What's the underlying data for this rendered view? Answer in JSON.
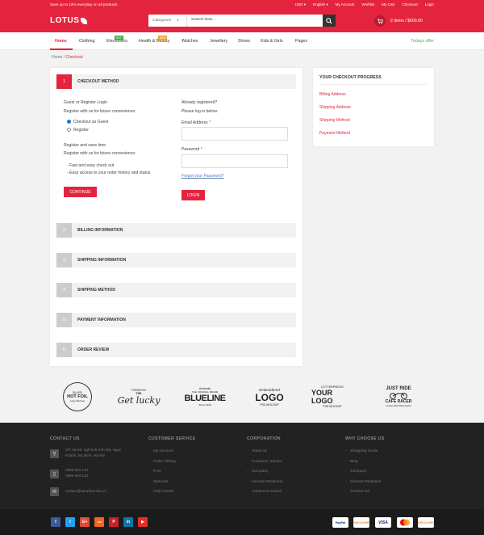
{
  "topbar": {
    "promo": "Save up to 12% everyday on all products",
    "currency": "USD ▾",
    "language": "English ▾",
    "links": [
      "My Account",
      "Wishlist",
      "My Cart",
      "Checkout",
      "Login"
    ]
  },
  "header": {
    "logo": "LOTUS",
    "search": {
      "category": "Categories",
      "placeholder": "Search here..."
    },
    "cart": "2 items / $600.00"
  },
  "nav": {
    "items": [
      "Home",
      "Clothing",
      "Electronics",
      "Health & Beauty",
      "Watches",
      "Jewellery",
      "Shoes",
      "Kids & Girls",
      "Pages"
    ],
    "badges": {
      "electronics": "HOT",
      "health": "NEW"
    },
    "today": "Todays offer"
  },
  "breadcrumb": {
    "home": "Home",
    "current": "Checkout"
  },
  "checkout": {
    "sections": [
      {
        "num": "1",
        "label": "CHECKOUT METHOD"
      },
      {
        "num": "2",
        "label": "BILLING INFORMATION"
      },
      {
        "num": "3",
        "label": "SHIPPING INFORMATION"
      },
      {
        "num": "4",
        "label": "SHIPPING METHOD"
      },
      {
        "num": "5",
        "label": "PAYMENT INFORMATION"
      },
      {
        "num": "6",
        "label": "ORDER REVIEW"
      }
    ],
    "left": {
      "heading": "Guest or Register Login",
      "register_text": "Register with us for future convenience:",
      "options": [
        "Checkout as Guest",
        "Register"
      ],
      "save_heading": "Register and save time",
      "save_text": "Register with us for future convenience:",
      "bullets": [
        "- Fast and easy check out",
        "- Easy access to your order history and status"
      ],
      "continue": "CONTINUE"
    },
    "right": {
      "heading": "Already registered?",
      "text": "Please log in below:",
      "email_label": "Email Address",
      "password_label": "Password",
      "required_mark": "*",
      "forgot": "Forgot your Password?",
      "login": "LOGIN"
    }
  },
  "progress": {
    "title": "YOUR CHECKOUT PROGRESS",
    "steps": [
      "Billing Address",
      "Shipping Address",
      "Shipping Method",
      "Payment Method"
    ]
  },
  "brands": {
    "silver": {
      "top": "SILVER",
      "main": "HOT FOIL",
      "sub": "Logo Mockup"
    },
    "getlucky": {
      "top": "· PRESENTS ·",
      "pre": "THE",
      "main": "Get lucky"
    },
    "blueline": {
      "top": "Authentic",
      "pre": "THE ORIGINAL BRAND",
      "main": "BLUELINE",
      "sub": "Since 1940"
    },
    "embroidered": {
      "top": "Embroidered",
      "main": "LOGO",
      "sub": "PSD MOCKUP"
    },
    "letterpress": {
      "top": "LETTERPRESS",
      "main": "YOUR LOGO",
      "sub": "PSD MOCKUP"
    },
    "justride": {
      "top": "JUST RIDE",
      "main": "CAFE RACER",
      "sub": "Custom Built Motorcycles"
    }
  },
  "footer": {
    "contact": {
      "title": "CONTACT US",
      "address": [
        "VP: 58 55, ngõ 649 Kim Mã, Ngọc",
        "Khánh, Ba Đình, Hà Nội"
      ],
      "phones": [
        "0989 949 123",
        "0989 949 123"
      ],
      "email": "contact@tamphat.edu.vn"
    },
    "service": {
      "title": "CUSTOMER SERVICE",
      "links": [
        "My Account",
        "Order History",
        "FAQ",
        "Specials",
        "Help Center"
      ]
    },
    "corporation": {
      "title": "CORPORATION",
      "links": [
        "About us",
        "Customer Service",
        "Company",
        "Investor Relations",
        "Advanced Search"
      ]
    },
    "why": {
      "title": "WHY CHOOSE US",
      "links": [
        "Shopping Guide",
        "Blog",
        "Company",
        "Investor Relations",
        "Contact Us"
      ]
    }
  },
  "social": [
    "f",
    "t",
    "G+",
    "rss",
    "P",
    "in",
    "▶"
  ],
  "payments": [
    "PayPal",
    "DISCOVER",
    "VISA",
    "",
    "DISCOVER"
  ],
  "colors": {
    "accent": "#e4243f",
    "footer": "#222222",
    "green": "#4caf50"
  }
}
